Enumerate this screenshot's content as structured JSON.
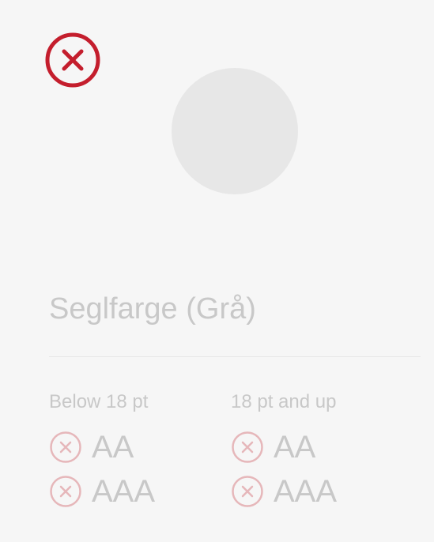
{
  "theme": {
    "background": "#f6f6f6",
    "accent_fail": "#c41e2d",
    "swatch_color": "#e7e7e7",
    "muted_text": "#c8c8c8",
    "muted_fail": "#e6b7ba"
  },
  "status_icon": "close-circle-icon",
  "color_name": "Seglfarge (Grå)",
  "columns": {
    "small_text": {
      "heading": "Below 18 pt",
      "ratings": [
        {
          "label": "AA",
          "icon": "fail-circle-icon",
          "pass": false
        },
        {
          "label": "AAA",
          "icon": "fail-circle-icon",
          "pass": false
        }
      ]
    },
    "large_text": {
      "heading": "18 pt and up",
      "ratings": [
        {
          "label": "AA",
          "icon": "fail-circle-icon",
          "pass": false
        },
        {
          "label": "AAA",
          "icon": "fail-circle-icon",
          "pass": false
        }
      ]
    }
  }
}
